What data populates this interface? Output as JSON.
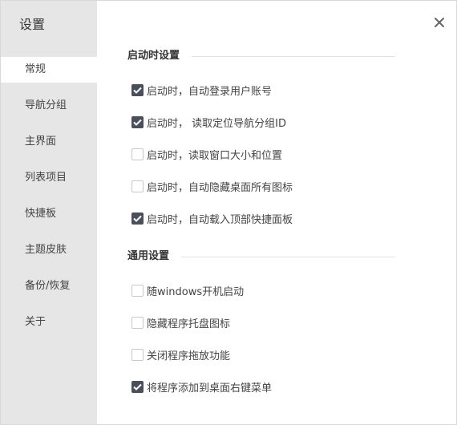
{
  "window": {
    "title": "设置"
  },
  "sidebar": {
    "items": [
      {
        "label": "常规",
        "active": true
      },
      {
        "label": "导航分组",
        "active": false
      },
      {
        "label": "主界面",
        "active": false
      },
      {
        "label": "列表项目",
        "active": false
      },
      {
        "label": "快捷板",
        "active": false
      },
      {
        "label": "主题皮肤",
        "active": false
      },
      {
        "label": "备份/恢复",
        "active": false
      },
      {
        "label": "关于",
        "active": false
      }
    ]
  },
  "close_icon": "close-icon",
  "sections": [
    {
      "title": "启动时设置",
      "options": [
        {
          "label": "启动时，自动登录用户账号",
          "checked": true
        },
        {
          "label": "启动时， 读取定位导航分组ID",
          "checked": true
        },
        {
          "label": "启动时，读取窗口大小和位置",
          "checked": false
        },
        {
          "label": "启动时，自动隐藏桌面所有图标",
          "checked": false
        },
        {
          "label": "启动时，自动载入顶部快捷面板",
          "checked": true
        }
      ]
    },
    {
      "title": "通用设置",
      "options": [
        {
          "label": "随windows开机启动",
          "checked": false
        },
        {
          "label": "隐藏程序托盘图标",
          "checked": false
        },
        {
          "label": "关闭程序拖放功能",
          "checked": false
        },
        {
          "label": "将程序添加到桌面右键菜单",
          "checked": true
        }
      ]
    }
  ],
  "colors": {
    "sidebar_bg": "#e6e6e6",
    "checkbox_checked": "#4a4f59"
  }
}
